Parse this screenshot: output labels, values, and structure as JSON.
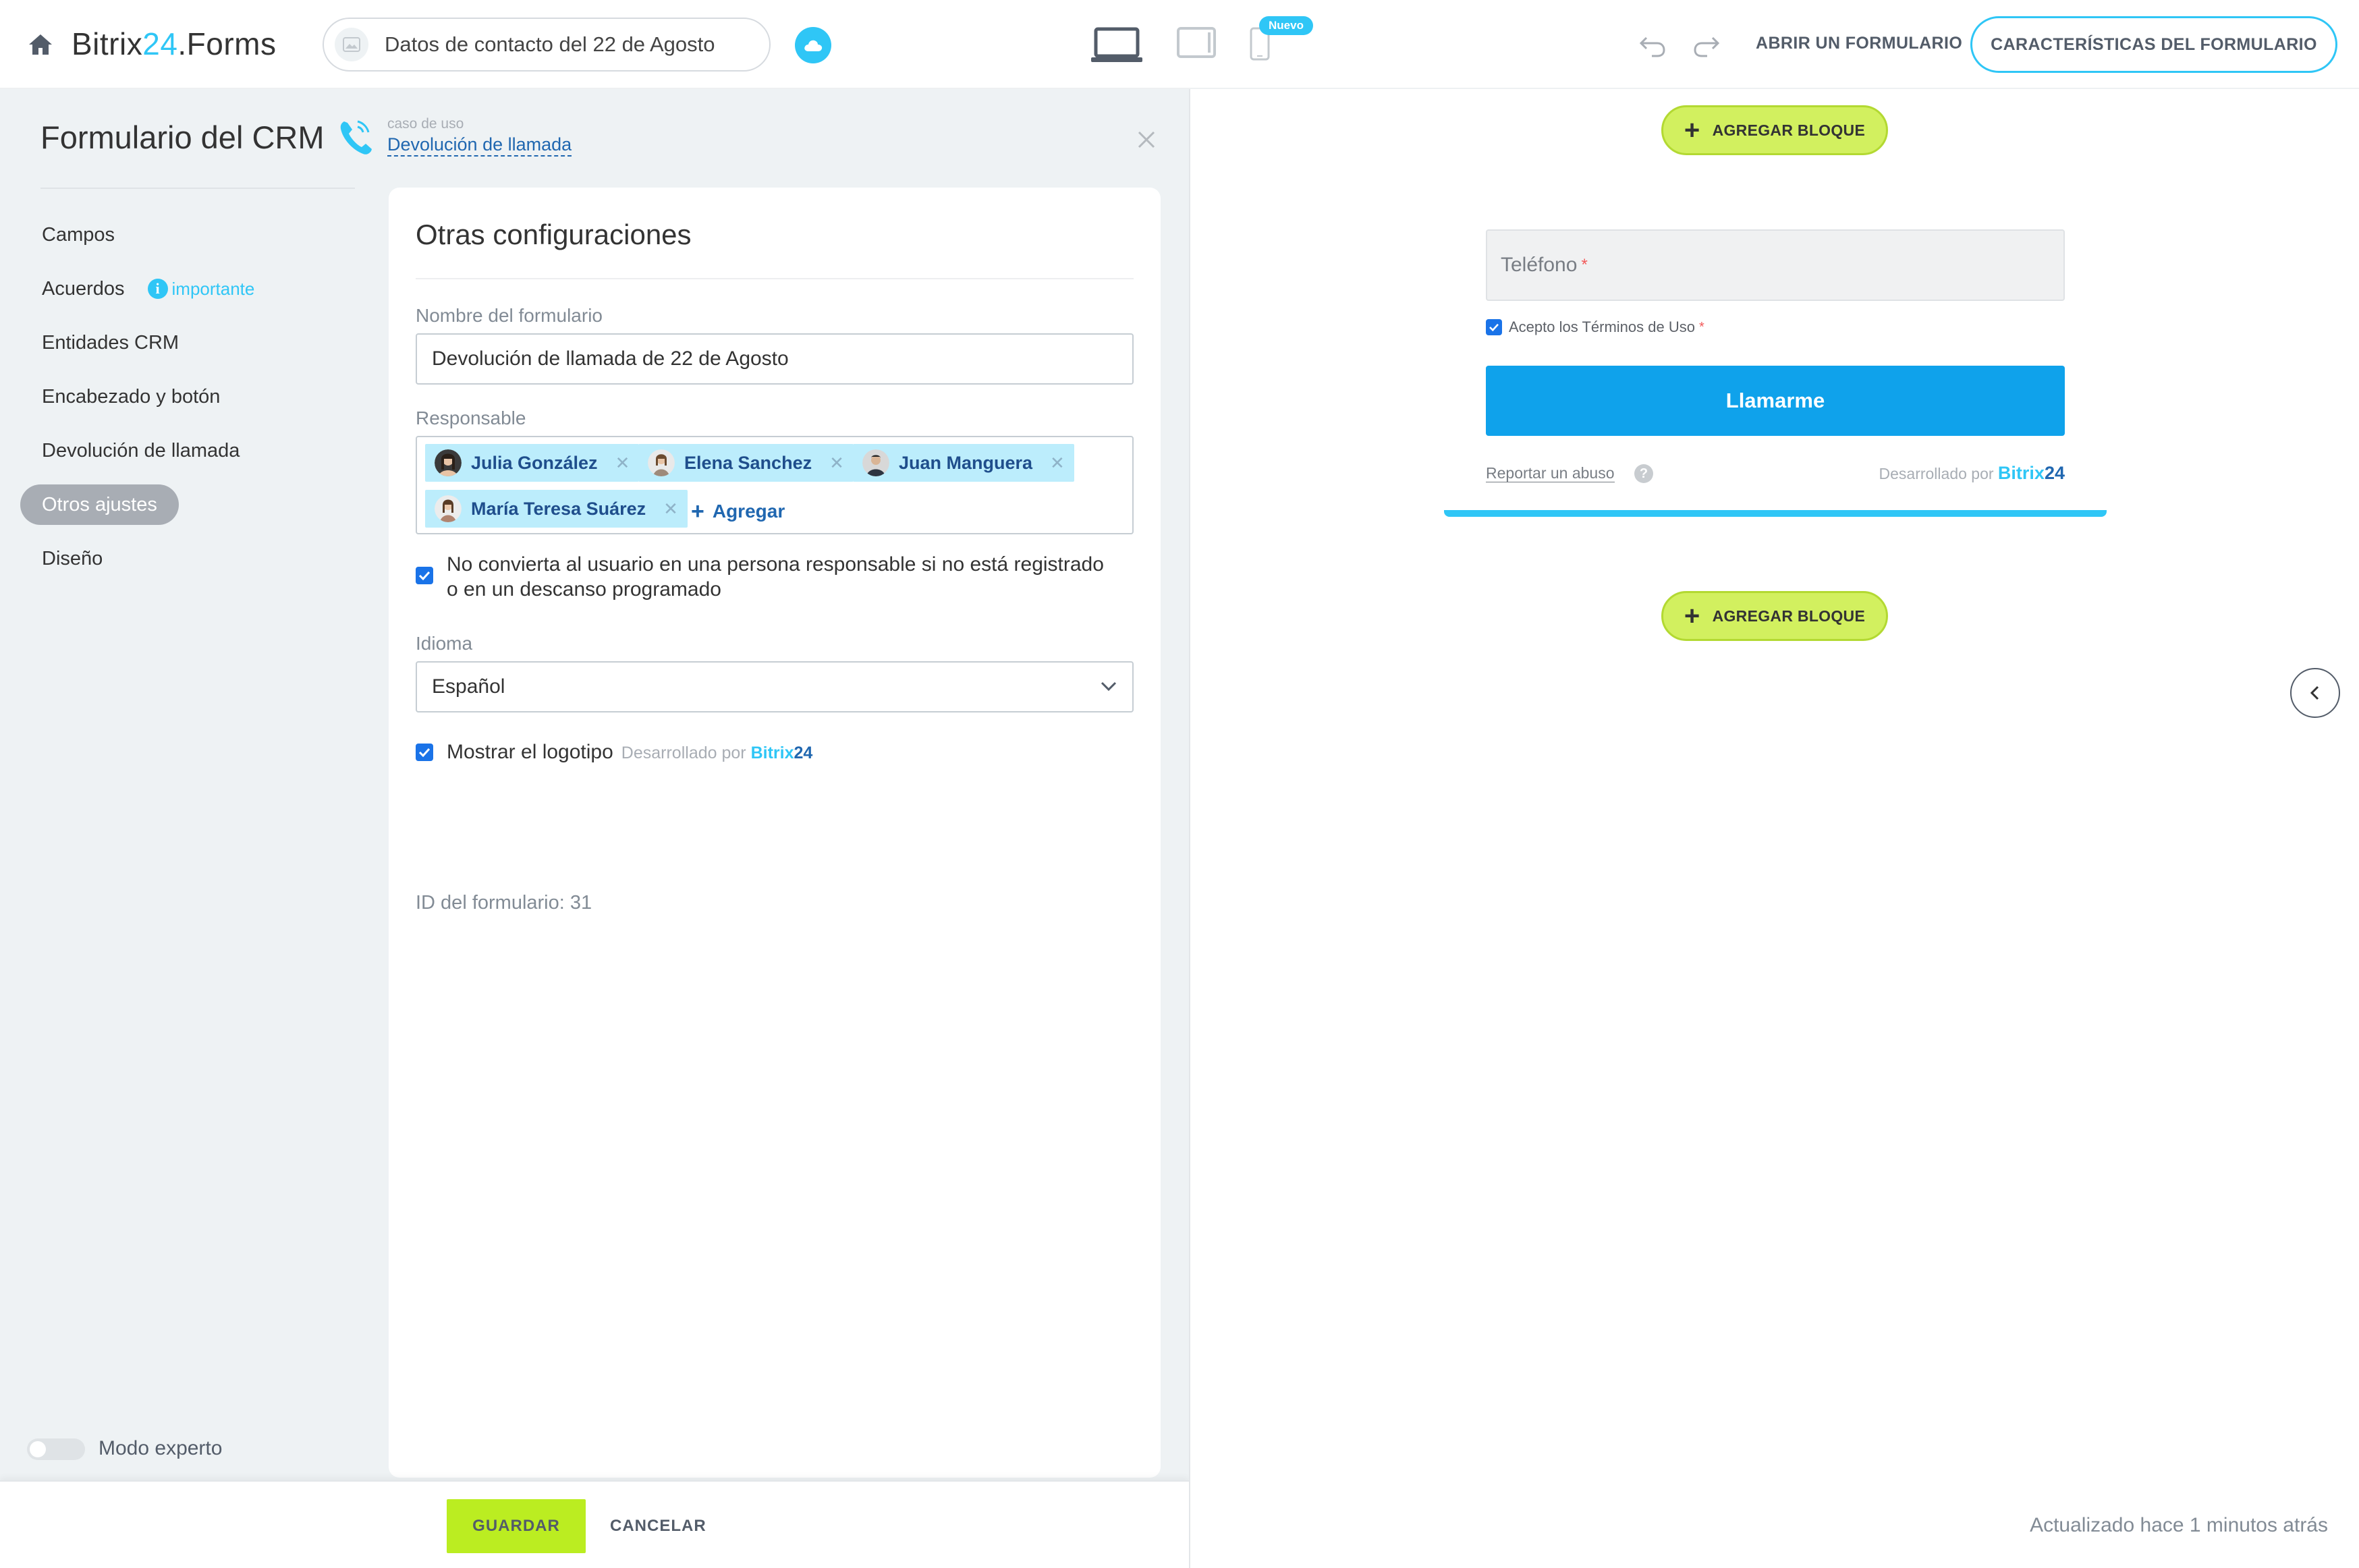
{
  "topbar": {
    "brand_prefix": "Bitrix",
    "brand_number": "24",
    "brand_suffix": ".Forms",
    "form_title": "Datos de contacto del 22 de Agosto",
    "new_badge": "Nuevo",
    "open_form_label": "ABRIR UN FORMULARIO",
    "features_label": "CARACTERÍSTICAS DEL FORMULARIO"
  },
  "sidebar": {
    "title": "Formulario del CRM",
    "usecase_label": "caso de uso",
    "usecase_value": "Devolución de llamada",
    "items": [
      {
        "label": "Campos"
      },
      {
        "label": "Acuerdos",
        "badge": "importante"
      },
      {
        "label": "Entidades CRM"
      },
      {
        "label": "Encabezado y botón"
      },
      {
        "label": "Devolución de llamada"
      },
      {
        "label": "Otros ajustes",
        "active": true
      },
      {
        "label": "Diseño"
      }
    ],
    "expert_mode_label": "Modo experto"
  },
  "settings": {
    "title": "Otras configuraciones",
    "form_name_label": "Nombre del formulario",
    "form_name_value": "Devolución de llamada de 22 de Agosto",
    "responsible_label": "Responsable",
    "responsibles": [
      "Julia González",
      "Elena Sanchez",
      "Juan Manguera",
      "María Teresa Suárez"
    ],
    "add_label": "Agregar",
    "no_convert_text_1": "No convierta al usuario en una persona responsable si no está registrado",
    "no_convert_text_2": "o en un descanso programado",
    "language_label": "Idioma",
    "language_value": "Español",
    "show_logo_label": "Mostrar el logotipo",
    "powered_by": "Desarrollado por",
    "powered_brand": "Bitrix",
    "powered_brand_num": "24",
    "form_id_text": "ID del formulario: 31"
  },
  "footer": {
    "save_label": "GUARDAR",
    "cancel_label": "CANCELAR"
  },
  "preview": {
    "add_block_label": "AGREGAR BLOQUE",
    "phone_placeholder": "Teléfono",
    "required_mark": "*",
    "terms_text": "Acepto los Términos de Uso",
    "call_button": "Llamarme",
    "report_link": "Reportar un abuso",
    "help_mark": "?",
    "powered_by": "Desarrollado por",
    "powered_brand": "Bitrix",
    "powered_brand_num": "24",
    "updated_text": "Actualizado hace 1 minutos atrás"
  },
  "colors": {
    "accent": "#2fc6f6",
    "link": "#2067b0",
    "save_green": "#bbed21",
    "add_block_green": "#d2f05f",
    "call_button": "#0fa2eb",
    "tag_bg": "#bcedfc"
  }
}
